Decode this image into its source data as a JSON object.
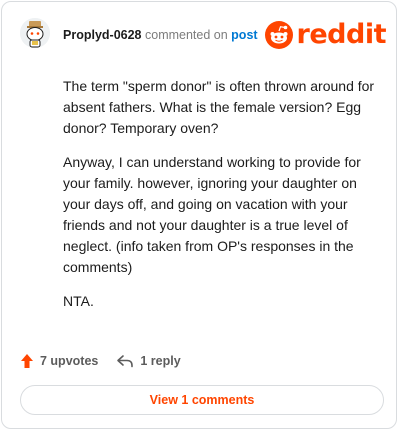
{
  "header": {
    "username": "Proplyd-0628",
    "verb": "commented on",
    "link_text": "post",
    "brand": "reddit"
  },
  "comment": {
    "paragraphs": [
      "The term \"sperm donor\" is often thrown around for absent fathers. What is the female version? Egg donor? Temporary oven?",
      "Anyway, I can understand working to provide for your family. however, ignoring your daughter on your days off, and going on vacation with your friends and not your daughter is a true level of neglect. (info taken from OP's responses in the comments)",
      "NTA."
    ]
  },
  "footer": {
    "upvotes_label": "7 upvotes",
    "reply_label": "1 reply",
    "view_comments_label": "View 1 comments"
  },
  "colors": {
    "brand_orange": "#ff4500",
    "link_blue": "#0079d3"
  },
  "icons": {
    "avatar": "snoo-avatar-icon",
    "logo": "reddit-snoo-icon",
    "upvote": "upvote-arrow-icon",
    "reply": "reply-arrow-icon"
  }
}
